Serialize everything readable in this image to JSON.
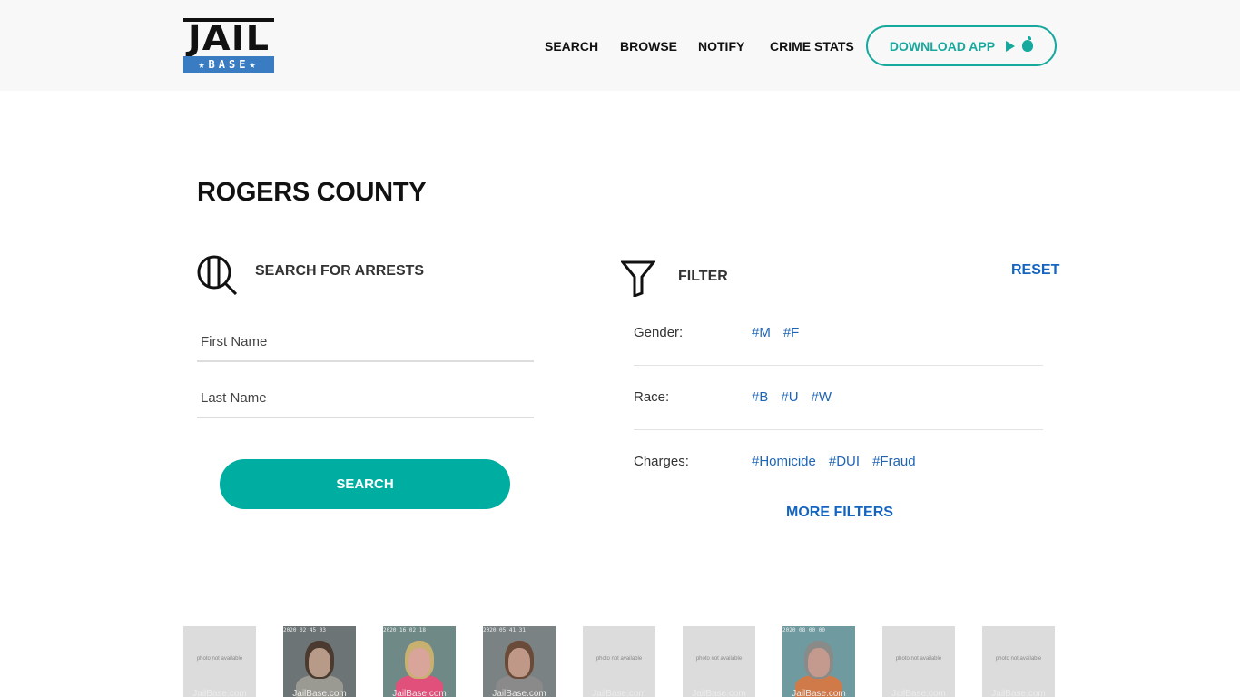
{
  "header": {
    "logo": {
      "top": "JAIL",
      "bottom": "★BASE★"
    },
    "nav": [
      {
        "label": "SEARCH"
      },
      {
        "label": "BROWSE"
      },
      {
        "label": "NOTIFY"
      },
      {
        "label": "CRIME STATS"
      }
    ],
    "download_app": {
      "label": "DOWNLOAD APP",
      "icons": [
        "google-play-icon",
        "apple-icon"
      ]
    }
  },
  "page_title": "ROGERS COUNTY",
  "search": {
    "title": "SEARCH FOR ARRESTS",
    "first_name": {
      "value": "",
      "placeholder": "First Name"
    },
    "last_name": {
      "value": "",
      "placeholder": "Last Name"
    },
    "button": "SEARCH"
  },
  "filter": {
    "title": "FILTER",
    "reset": "RESET",
    "rows": [
      {
        "label": "Gender:",
        "tags": [
          "#M",
          "#F"
        ]
      },
      {
        "label": "Race:",
        "tags": [
          "#B",
          "#U",
          "#W"
        ]
      },
      {
        "label": "Charges:",
        "tags": [
          "#Homicide",
          "#DUI",
          "#Fraud"
        ]
      }
    ],
    "more": "MORE FILTERS"
  },
  "gallery": {
    "placeholder_text": "photo not available",
    "watermark": "JailBase.com",
    "photos": [
      {
        "available": false,
        "timestamp": ""
      },
      {
        "available": true,
        "timestamp": "2020 02 45 03"
      },
      {
        "available": true,
        "timestamp": "2020 16 02 18"
      },
      {
        "available": true,
        "timestamp": "2020 05 41 31"
      },
      {
        "available": false,
        "timestamp": ""
      },
      {
        "available": false,
        "timestamp": ""
      },
      {
        "available": true,
        "timestamp": "2020 08 00 00"
      },
      {
        "available": false,
        "timestamp": ""
      },
      {
        "available": false,
        "timestamp": ""
      }
    ]
  }
}
